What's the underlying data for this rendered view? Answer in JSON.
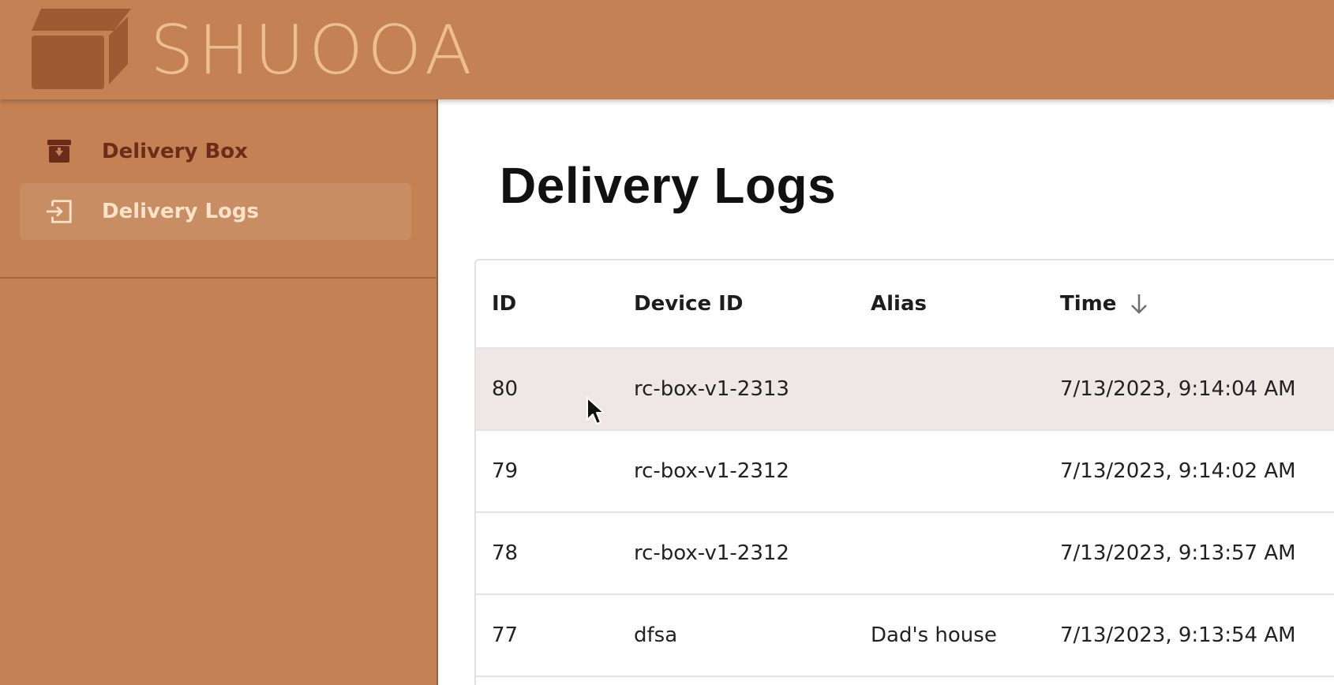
{
  "header": {
    "logo_text": "SHUOOA",
    "logo_icon": "box-icon"
  },
  "sidebar": {
    "items": [
      {
        "label": "Delivery Box",
        "icon": "archive-icon",
        "active": false
      },
      {
        "label": "Delivery Logs",
        "icon": "login-icon",
        "active": true
      }
    ]
  },
  "main": {
    "title": "Delivery Logs",
    "table": {
      "columns": [
        "ID",
        "Device ID",
        "Alias",
        "Time"
      ],
      "sort": {
        "column": "Time",
        "direction": "descending",
        "icon": "arrow-down-icon"
      },
      "rows": [
        {
          "id": "80",
          "device_id": "rc-box-v1-2313",
          "alias": "",
          "time": "7/13/2023, 9:14:04 AM"
        },
        {
          "id": "79",
          "device_id": "rc-box-v1-2312",
          "alias": "",
          "time": "7/13/2023, 9:14:02 AM"
        },
        {
          "id": "78",
          "device_id": "rc-box-v1-2312",
          "alias": "",
          "time": "7/13/2023, 9:13:57 AM"
        },
        {
          "id": "77",
          "device_id": "dfsa",
          "alias": "Dad's house",
          "time": "7/13/2023, 9:13:54 AM"
        }
      ]
    }
  },
  "colors": {
    "brand": "#c48154",
    "logo_text": "#ebbf8f",
    "nav_active_bg": "#c98d64",
    "nav_active_text": "#fbe3c8",
    "nav_text": "#6b2c1a",
    "hover_row": "#efe7e6"
  }
}
